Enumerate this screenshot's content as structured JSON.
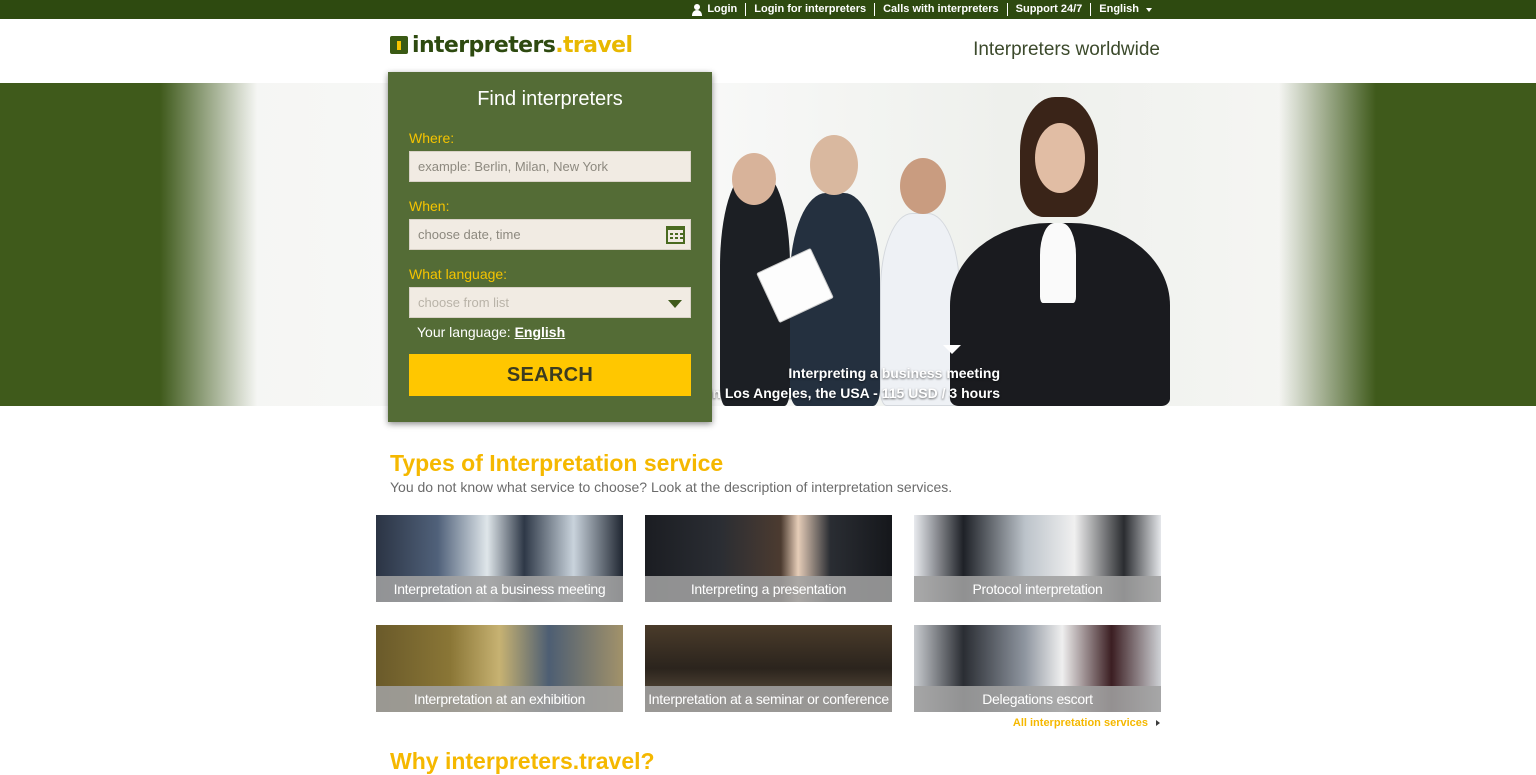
{
  "topbar": {
    "login": "Login",
    "login_interpreters": "Login for interpreters",
    "calls": "Calls with interpreters",
    "support": "Support 24/7",
    "language": "English"
  },
  "header": {
    "logo_main": "interpreters",
    "logo_dot": ".",
    "logo_tld": "travel",
    "tagline": "Interpreters worldwide"
  },
  "hero": {
    "caption_line1": "Interpreting a business meeting",
    "caption_line2": "in Los Angeles, the USA - 115 USD / 3 hours"
  },
  "search": {
    "title": "Find interpreters",
    "where_label": "Where:",
    "where_placeholder": "example: Berlin, Milan, New York",
    "when_label": "When:",
    "when_placeholder": "choose date, time",
    "language_label": "What language:",
    "language_placeholder": "choose from list",
    "your_language_prefix": "Your language:",
    "your_language": "English",
    "button": "SEARCH"
  },
  "services": {
    "title": "Types of Interpretation service",
    "subtitle": "You do not know what service to choose? Look at the description of interpretation services.",
    "items": [
      {
        "label": "Interpretation at a business meeting"
      },
      {
        "label": "Interpreting a presentation"
      },
      {
        "label": "Protocol interpretation"
      },
      {
        "label": "Interpretation at an exhibition"
      },
      {
        "label": "Interpretation at a seminar or conference"
      },
      {
        "label": "Delegations escort"
      }
    ],
    "all_link": "All interpretation services"
  },
  "why": {
    "title": "Why interpreters.travel?"
  },
  "colors": {
    "brand_green": "#2e4a10",
    "panel_green": "#546c36",
    "accent_yellow": "#ffc700"
  }
}
